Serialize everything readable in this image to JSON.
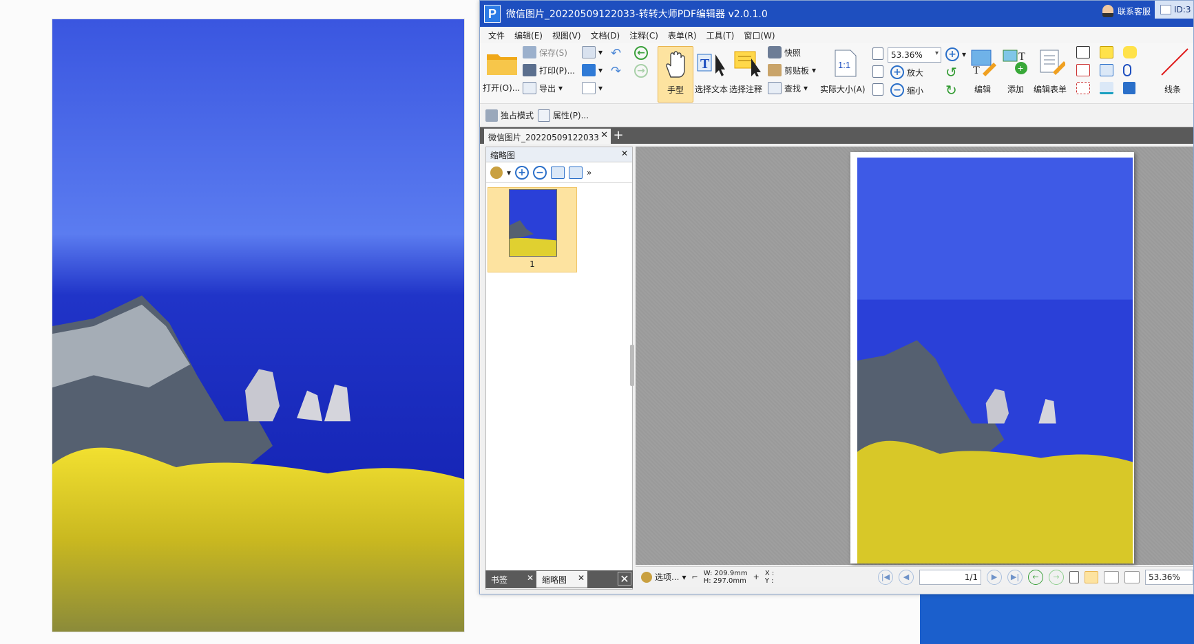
{
  "window": {
    "title": "微信图片_20220509122033-转转大师PDF编辑器 v2.0.1.0",
    "support_label": "联系客服",
    "id_label": "ID:3"
  },
  "menu": [
    "文件",
    "编辑(E)",
    "视图(V)",
    "文档(D)",
    "注释(C)",
    "表单(R)",
    "工具(T)",
    "窗口(W)"
  ],
  "ribbon": {
    "open": "打开(O)...",
    "save": "保存(S)",
    "print": "打印(P)...",
    "export": "导出",
    "hand": "手型",
    "select_text": "选择文本",
    "select_annot": "选择注释",
    "snapshot": "快照",
    "clipboard": "剪贴板",
    "find": "查找",
    "actual_size": "实际大小(A)",
    "zoom_value": "53.36%",
    "zoom_in": "放大",
    "zoom_out": "缩小",
    "edit": "编辑",
    "add": "添加",
    "edit_form": "编辑表单",
    "line": "线条"
  },
  "subbar": {
    "exclusive": "独占模式",
    "properties": "属性(P)..."
  },
  "doc_tab": "微信图片_20220509122033",
  "panel": {
    "title": "缩略图",
    "page_number": "1",
    "tab_bookmark": "书签",
    "tab_thumbnail": "缩略图"
  },
  "status": {
    "options": "选项...",
    "width": "W: 209.9mm",
    "height": "H: 297.0mm",
    "x": "X :",
    "y": "Y :",
    "page": "1/1",
    "zoom": "53.36%"
  }
}
